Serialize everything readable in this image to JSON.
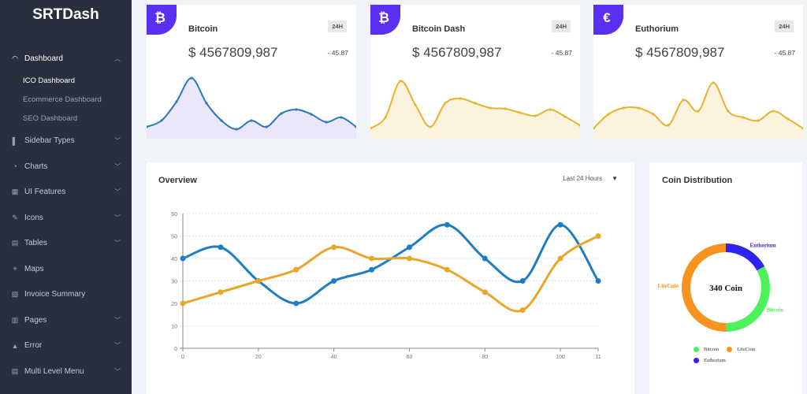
{
  "brand": "SRTDash",
  "sidebar": {
    "items": [
      {
        "label": "Dashboard",
        "icon": "dashboard-icon",
        "glyph": "◠",
        "chevron": "︿",
        "active": true
      },
      {
        "label": "Sidebar Types",
        "icon": "sidebar-types-icon",
        "glyph": "▌",
        "chevron": "﹀"
      },
      {
        "label": "Charts",
        "icon": "charts-icon",
        "glyph": "◔",
        "chevron": "﹀"
      },
      {
        "label": "UI Features",
        "icon": "ui-features-icon",
        "glyph": "▦",
        "chevron": "﹀"
      },
      {
        "label": "Icons",
        "icon": "icons-icon",
        "glyph": "✎",
        "chevron": "﹀"
      },
      {
        "label": "Tables",
        "icon": "tables-icon",
        "glyph": "▤",
        "chevron": "﹀"
      },
      {
        "label": "Maps",
        "icon": "maps-icon",
        "glyph": "⌖",
        "chevron": ""
      },
      {
        "label": "Invoice Summary",
        "icon": "invoice-icon",
        "glyph": "▧",
        "chevron": ""
      },
      {
        "label": "Pages",
        "icon": "pages-icon",
        "glyph": "▥",
        "chevron": "﹀"
      },
      {
        "label": "Error",
        "icon": "error-icon",
        "glyph": "▲",
        "chevron": "﹀"
      },
      {
        "label": "Multi Level Menu",
        "icon": "multi-level-icon",
        "glyph": "▤",
        "chevron": "﹀"
      }
    ],
    "dashboard_sub": [
      {
        "label": "ICO Dashboard",
        "active": true
      },
      {
        "label": "Ecommerce Dashboard"
      },
      {
        "label": "SEO Dashboard"
      }
    ]
  },
  "coins": [
    {
      "name": "Bitcoin",
      "period": "24H",
      "amount": "$ 4567809,987",
      "change": "- 45.87",
      "symbol": "₿",
      "badge_color": "#5b2ff1",
      "line_color": "#2a7ab8",
      "fill_color": "#ece6fb",
      "spark": [
        20,
        28,
        52,
        82,
        50,
        28,
        17,
        28,
        20,
        37,
        42,
        36,
        26,
        32,
        20
      ]
    },
    {
      "name": "Bitcoin Dash",
      "period": "24H",
      "amount": "$ 4567809,987",
      "change": "- 45.87",
      "symbol": "₿",
      "badge_color": "#5b2ff1",
      "line_color": "#e9b22c",
      "fill_color": "#fcf3de",
      "spark": [
        18,
        32,
        78,
        48,
        20,
        50,
        56,
        50,
        44,
        43,
        38,
        34,
        42,
        33,
        22
      ]
    },
    {
      "name": "Euthorium",
      "period": "24H",
      "amount": "$ 4567809,987",
      "change": "- 45.87",
      "symbol": "€",
      "badge_color": "#5b2ff1",
      "line_color": "#e9b22c",
      "fill_color": "#fcf3de",
      "spark": [
        18,
        36,
        44,
        44,
        36,
        22,
        54,
        40,
        76,
        40,
        32,
        28,
        40,
        30,
        18
      ]
    }
  ],
  "overview": {
    "title": "Overview",
    "range_label": "Last 24 Hours",
    "caret": "▼"
  },
  "chart_data": {
    "type": "line",
    "x_ticks": [
      "0",
      "20",
      "40",
      "60",
      "80",
      "100",
      "11"
    ],
    "y_ticks": [
      "0",
      "10",
      "20",
      "30",
      "40",
      "50",
      "60"
    ],
    "ylim": [
      0,
      60
    ],
    "series": [
      {
        "color": "#1f7ec3",
        "x": [
          0,
          10,
          20,
          30,
          40,
          50,
          60,
          70,
          80,
          90,
          100,
          110
        ],
        "y": [
          40,
          45,
          30,
          20,
          30,
          35,
          45,
          55,
          40,
          30,
          55,
          30
        ]
      },
      {
        "color": "#e9a62a",
        "x": [
          0,
          10,
          20,
          30,
          40,
          50,
          60,
          70,
          80,
          90,
          100,
          110
        ],
        "y": [
          20,
          25,
          30,
          35,
          45,
          40,
          40,
          35,
          25,
          17,
          40,
          50
        ]
      }
    ]
  },
  "distribution": {
    "title": "Coin Distribution",
    "center_label": "340 Coin",
    "segments": [
      {
        "name": "Bitcoin",
        "value": 33,
        "color": "#4df25b"
      },
      {
        "name": "LiteCoin",
        "value": 50,
        "color": "#f7931e"
      },
      {
        "name": "Euthorium",
        "value": 17,
        "color": "#2e23f0"
      }
    ]
  }
}
